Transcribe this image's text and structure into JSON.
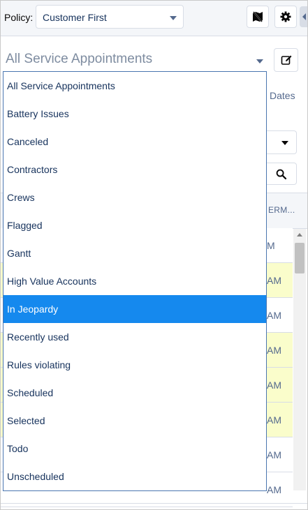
{
  "toolbar": {
    "policy_label": "Policy:",
    "policy_value": "Customer First",
    "icons": [
      "map-toggle-icon",
      "gear-icon"
    ]
  },
  "view": {
    "title": "All Service Appointments",
    "edit_icon": "edit-icon"
  },
  "filters": {
    "dates_label": "Dates"
  },
  "table": {
    "column_header": "ERM...",
    "rows": [
      {
        "text": "M",
        "highlight": false
      },
      {
        "text": "AM",
        "highlight": true
      },
      {
        "text": "AM",
        "highlight": false
      },
      {
        "text": "AM",
        "highlight": true
      },
      {
        "text": "AM",
        "highlight": true
      },
      {
        "text": "AM",
        "highlight": true
      },
      {
        "text": "AM",
        "highlight": false
      },
      {
        "text": "AM",
        "highlight": false
      }
    ]
  },
  "dropdown": {
    "selected": "In Jeopardy",
    "items": [
      "All Service Appointments",
      "Battery Issues",
      "Canceled",
      "Contractors",
      "Crews",
      "Flagged",
      "Gantt",
      "High Value Accounts",
      "In Jeopardy",
      "Recently used",
      "Rules violating",
      "Scheduled",
      "Selected",
      "Todo",
      "Unscheduled"
    ]
  },
  "colors": {
    "accent": "#1589ee",
    "highlight_row": "#fafdcb",
    "border": "#d8dde6",
    "text": "#16325c"
  }
}
